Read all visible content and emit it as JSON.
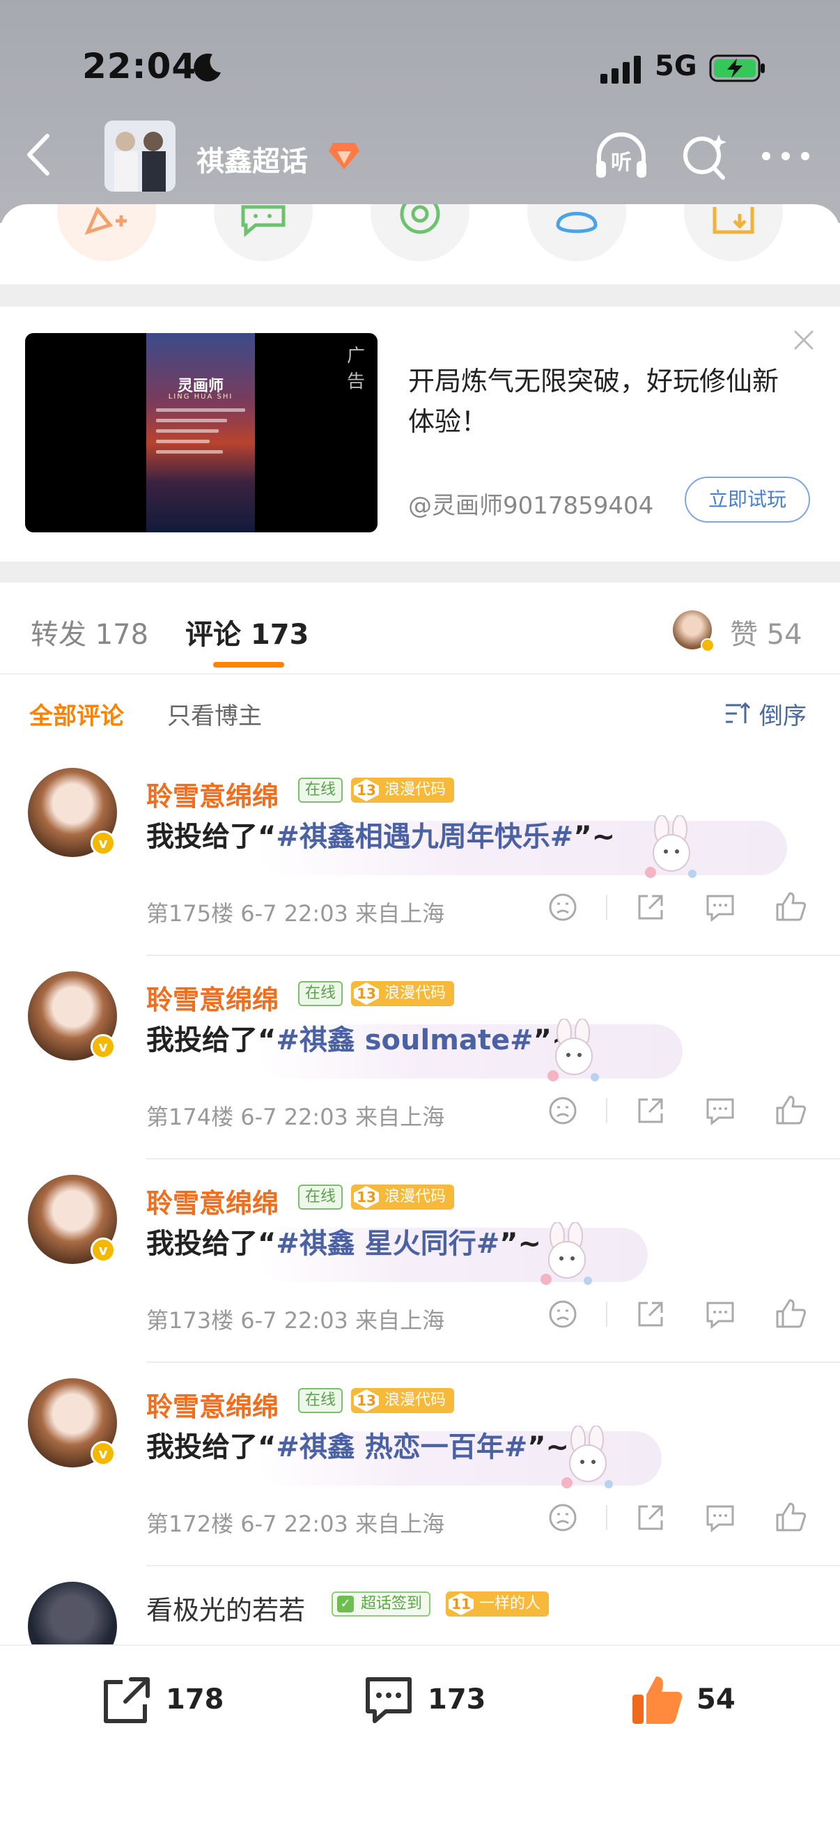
{
  "status_bar": {
    "time": "22:04",
    "network": "5G"
  },
  "nav": {
    "title": "祺鑫超话"
  },
  "ad": {
    "tag": "广告",
    "poster_title": "灵画师",
    "poster_subtitle": "LING HUA SHI",
    "headline": "开局炼气无限突破，好玩修仙新体验！",
    "author": "@灵画师9017859404",
    "cta": "立即试玩"
  },
  "tabs": {
    "repost": "转发 178",
    "comment": "评论 173",
    "like": "赞 54"
  },
  "filter": {
    "all": "全部评论",
    "owner_only": "只看博主",
    "sort": "倒序"
  },
  "comments": [
    {
      "name": "聆雪意绵绵",
      "status": "在线",
      "level": "13",
      "level_label": "浪漫代码",
      "prefix": "我投给了“",
      "topic": "#祺鑫相遇九周年快乐#",
      "suffix": "”~",
      "meta": "第175楼  6-7 22:03  来自上海"
    },
    {
      "name": "聆雪意绵绵",
      "status": "在线",
      "level": "13",
      "level_label": "浪漫代码",
      "prefix": "我投给了“",
      "topic": "#祺鑫 soulmate#",
      "suffix": "”~",
      "meta": "第174楼  6-7 22:03  来自上海"
    },
    {
      "name": "聆雪意绵绵",
      "status": "在线",
      "level": "13",
      "level_label": "浪漫代码",
      "prefix": "我投给了“",
      "topic": "#祺鑫 星火同行#",
      "suffix": "”~",
      "meta": "第173楼  6-7 22:03  来自上海"
    },
    {
      "name": "聆雪意绵绵",
      "status": "在线",
      "level": "13",
      "level_label": "浪漫代码",
      "prefix": "我投给了“",
      "topic": "#祺鑫 热恋一百年#",
      "suffix": "”~",
      "meta": "第172楼  6-7 22:03  来自上海"
    }
  ],
  "partial_comment": {
    "name": "看极光的若若",
    "sign_label": "超话签到",
    "level": "11",
    "level_label": "一样的人"
  },
  "bottom_bar": {
    "repost": "178",
    "comment": "173",
    "like": "54"
  },
  "colors": {
    "accent": "#ff8200",
    "username": "#f06e1e",
    "topic": "#4a62a3"
  }
}
